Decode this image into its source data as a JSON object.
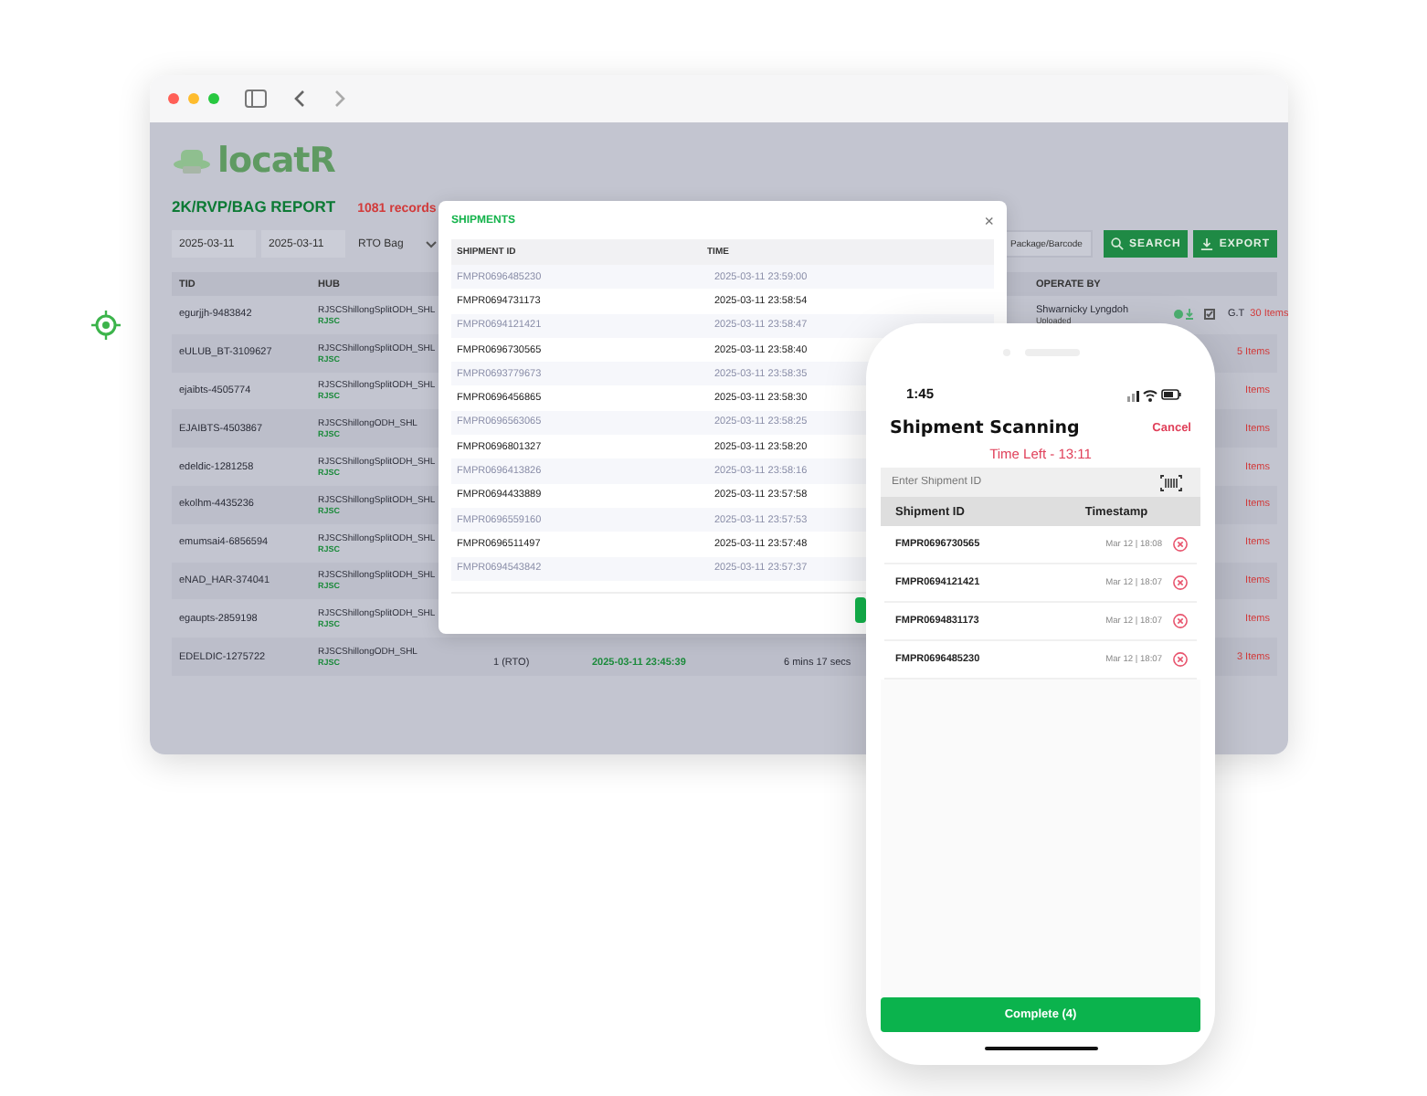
{
  "app": {
    "logo": "locatR",
    "report_title": "2K/RVP/BAG REPORT",
    "record_count": "1081 records",
    "filters": {
      "date_from": "2025-03-11",
      "date_to": "2025-03-11",
      "type": "RTO Bag",
      "barcode_placeholder": "Package/Barcode"
    },
    "buttons": [
      "SEARCH",
      "EXPORT"
    ],
    "table": {
      "columns": [
        "TID",
        "HUB",
        "OPERATE BY"
      ],
      "rows": [
        {
          "tid": "egurjjh-9483842",
          "hub": "RJSCShillongSplitODH_SHL",
          "hub_tag": "RJSC",
          "operator": "Shwarnicky Lyngdoh",
          "operator_status": "Uploaded",
          "flag": "G.T",
          "items": "30 Items"
        },
        {
          "tid": "eULUB_BT-3109627",
          "hub": "RJSCShillongSplitODH_SHL",
          "hub_tag": "RJSC",
          "items": "5 Items"
        },
        {
          "tid": "ejaibts-4505774",
          "hub": "RJSCShillongSplitODH_SHL",
          "hub_tag": "RJSC",
          "items": "Items"
        },
        {
          "tid": "EJAIBTS-4503867",
          "hub": "RJSCShillongODH_SHL",
          "hub_tag": "RJSC",
          "items": "Items"
        },
        {
          "tid": "edeldic-1281258",
          "hub": "RJSCShillongSplitODH_SHL",
          "hub_tag": "RJSC",
          "items": "Items"
        },
        {
          "tid": "ekolhm-4435236",
          "hub": "RJSCShillongSplitODH_SHL",
          "hub_tag": "RJSC",
          "items": "Items"
        },
        {
          "tid": "emumsai4-6856594",
          "hub": "RJSCShillongSplitODH_SHL",
          "hub_tag": "RJSC",
          "items": "Items"
        },
        {
          "tid": "eNAD_HAR-374041",
          "hub": "RJSCShillongSplitODH_SHL",
          "hub_tag": "RJSC",
          "items": "Items"
        },
        {
          "tid": "egaupts-2859198",
          "hub": "RJSCShillongSplitODH_SHL",
          "hub_tag": "RJSC",
          "items": "Items"
        },
        {
          "tid": "EDELDIC-1275722",
          "hub": "RJSCShillongODH_SHL",
          "hub_tag": "RJSC",
          "quantity": "1 (RTO)",
          "time": "2025-03-11 23:45:39",
          "duration": "6 mins 17 secs",
          "items": "3 Items"
        }
      ]
    }
  },
  "modal": {
    "title": "SHIPMENTS",
    "close": "×",
    "columns": [
      "SHIPMENT ID",
      "TIME"
    ],
    "rows": [
      {
        "id": "FMPR0696485230",
        "time": "2025-03-11 23:59:00"
      },
      {
        "id": "FMPR0694731173",
        "time": "2025-03-11 23:58:54"
      },
      {
        "id": "FMPR0694121421",
        "time": "2025-03-11 23:58:47"
      },
      {
        "id": "FMPR0696730565",
        "time": "2025-03-11 23:58:40"
      },
      {
        "id": "FMPR0693779673",
        "time": "2025-03-11 23:58:35"
      },
      {
        "id": "FMPR0696456865",
        "time": "2025-03-11 23:58:30"
      },
      {
        "id": "FMPR0696563065",
        "time": "2025-03-11 23:58:25"
      },
      {
        "id": "FMPR0696801327",
        "time": "2025-03-11 23:58:20"
      },
      {
        "id": "FMPR0696413826",
        "time": "2025-03-11 23:58:16"
      },
      {
        "id": "FMPR0694433889",
        "time": "2025-03-11 23:57:58"
      },
      {
        "id": "FMPR0696559160",
        "time": "2025-03-11 23:57:53"
      },
      {
        "id": "FMPR0696511497",
        "time": "2025-03-11 23:57:48"
      },
      {
        "id": "FMPR0694543842",
        "time": "2025-03-11 23:57:37"
      }
    ]
  },
  "phone": {
    "clock": "1:45",
    "title": "Shipment Scanning",
    "cancel": "Cancel",
    "time_left": "Time Left - 13:11",
    "input_placeholder": "Enter Shipment ID",
    "columns": [
      "Shipment ID",
      "Timestamp"
    ],
    "rows": [
      {
        "id": "FMPR0696730565",
        "timestamp": "Mar 12 | 18:08"
      },
      {
        "id": "FMPR0694121421",
        "timestamp": "Mar 12 | 18:07"
      },
      {
        "id": "FMPR0694831173",
        "timestamp": "Mar 12 | 18:07"
      },
      {
        "id": "FMPR0696485230",
        "timestamp": "Mar 12 | 18:07"
      }
    ],
    "complete_button": "Complete  (4)"
  }
}
